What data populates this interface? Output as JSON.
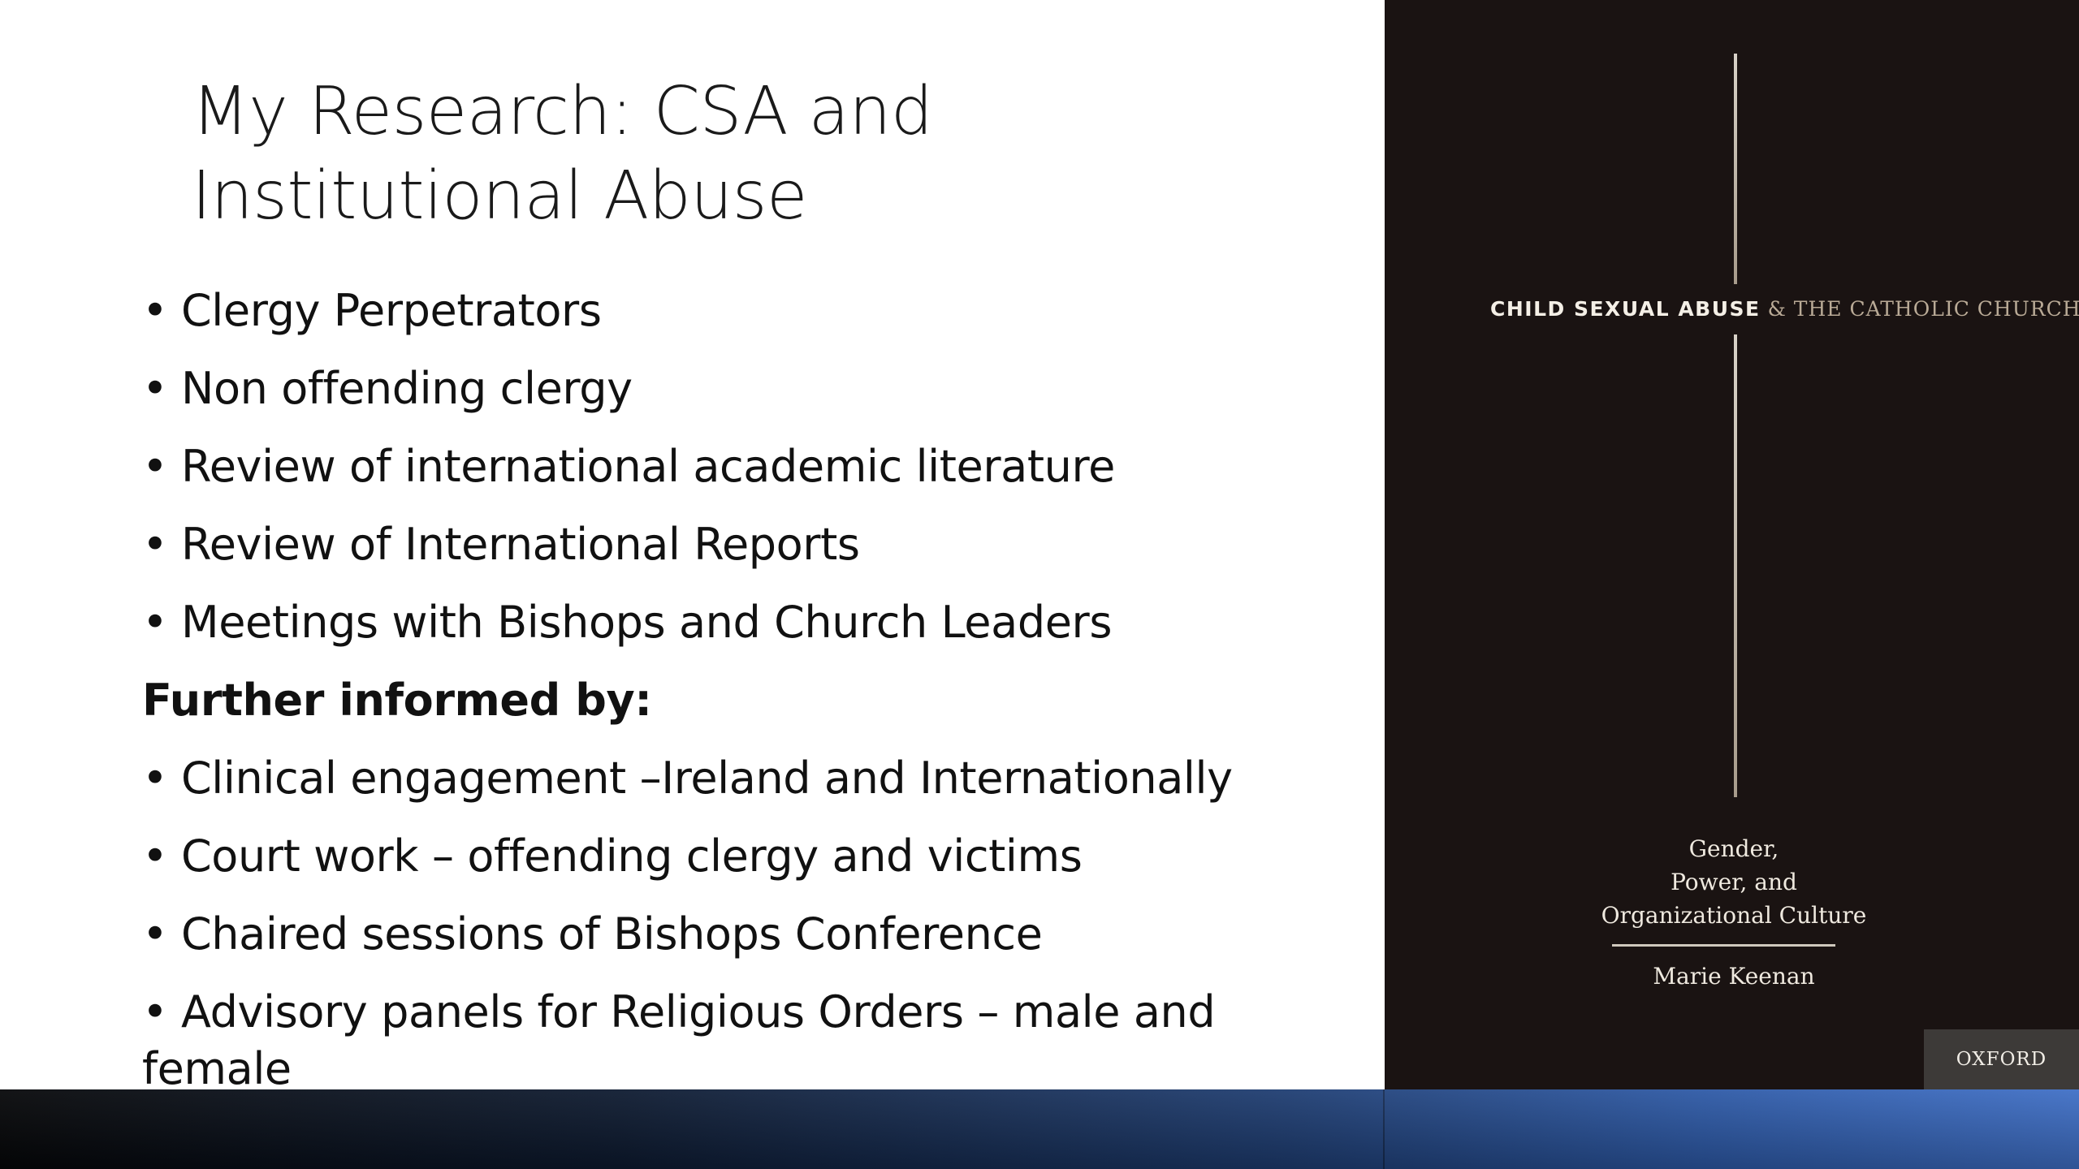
{
  "slide": {
    "title_lines": [
      "My Research: CSA and",
      "Institutional Abuse"
    ],
    "bullets_primary": [
      "Clergy Perpetrators",
      "Non offending clergy",
      "Review of international academic literature",
      "Review of International Reports",
      "Meetings with Bishops and Church Leaders"
    ],
    "subheading": "Further informed by:",
    "bullets_secondary": [
      "Clinical engagement –Ireland and Internationally",
      "Court work – offending clergy and victims",
      "Chaired sessions of Bishops Conference",
      "Advisory panels for Religious Orders – male and female"
    ],
    "bullet_glyph": "•"
  },
  "book_cover": {
    "title_part1": "CHILD SEXUAL ABUSE",
    "title_part2": " & THE CATHOLIC CHURCH",
    "subtitle_lines": [
      "Gender,",
      "Power, and",
      "Organizational Culture"
    ],
    "author": "Marie Keenan",
    "publisher": "OXFORD",
    "background_color": "#1a1312"
  },
  "colors": {
    "slide_background": "#ffffff",
    "text": "#111111",
    "band_start": "#050608",
    "band_end": "#3f6fc6"
  }
}
